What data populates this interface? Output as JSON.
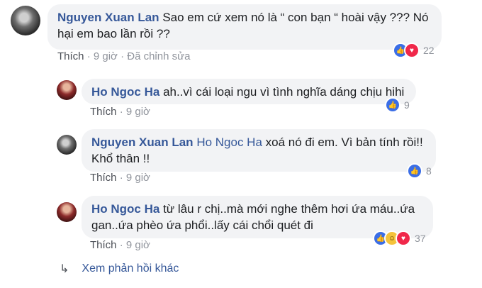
{
  "comments": [
    {
      "author": "Nguyen Xuan Lan",
      "text_line1": "Sao em cứ xem nó là “ con bạn “ hoài vậy ??? Nó",
      "text_line2": "hại em bao lần rồi ??",
      "like_label": "Thích",
      "time": "9 giờ",
      "edited": "Đã chỉnh sửa",
      "reaction_count": "22",
      "reactions": [
        "like-icon",
        "love-icon"
      ]
    },
    {
      "author": "Ho Ngoc Ha",
      "text": "ah..vì cái loại ngu vì tình nghĩa dáng chịu hihi",
      "like_label": "Thích",
      "time": "9 giờ",
      "reaction_count": "9",
      "reactions": [
        "like-icon"
      ]
    },
    {
      "author": "Nguyen Xuan Lan",
      "mention": "Ho Ngoc Ha",
      "text_line1": "xoá nó đi em. Vì bản tính rồi!!",
      "text_line2": "Khổ thân !!",
      "like_label": "Thích",
      "time": "9 giờ",
      "reaction_count": "8",
      "reactions": [
        "like-icon"
      ]
    },
    {
      "author": "Ho Ngoc Ha",
      "text_line1": "từ lâu r chị..mà mới nghe thêm hơi ứa máu..ứa",
      "text_line2": "gan..ứa phèo ứa phổi..lấy cái chổi quét đi",
      "like_label": "Thích",
      "time": "9 giờ",
      "reaction_count": "37",
      "reactions": [
        "like-icon",
        "haha-icon",
        "love-icon"
      ]
    }
  ],
  "more_replies": "Xem phản hồi khác",
  "separator": "·",
  "colors": {
    "link": "#365899",
    "bubble": "#f2f3f5",
    "meta": "#90949c",
    "like": "#3b6ee6",
    "love": "#f0284a",
    "haha": "#f5c33b"
  }
}
